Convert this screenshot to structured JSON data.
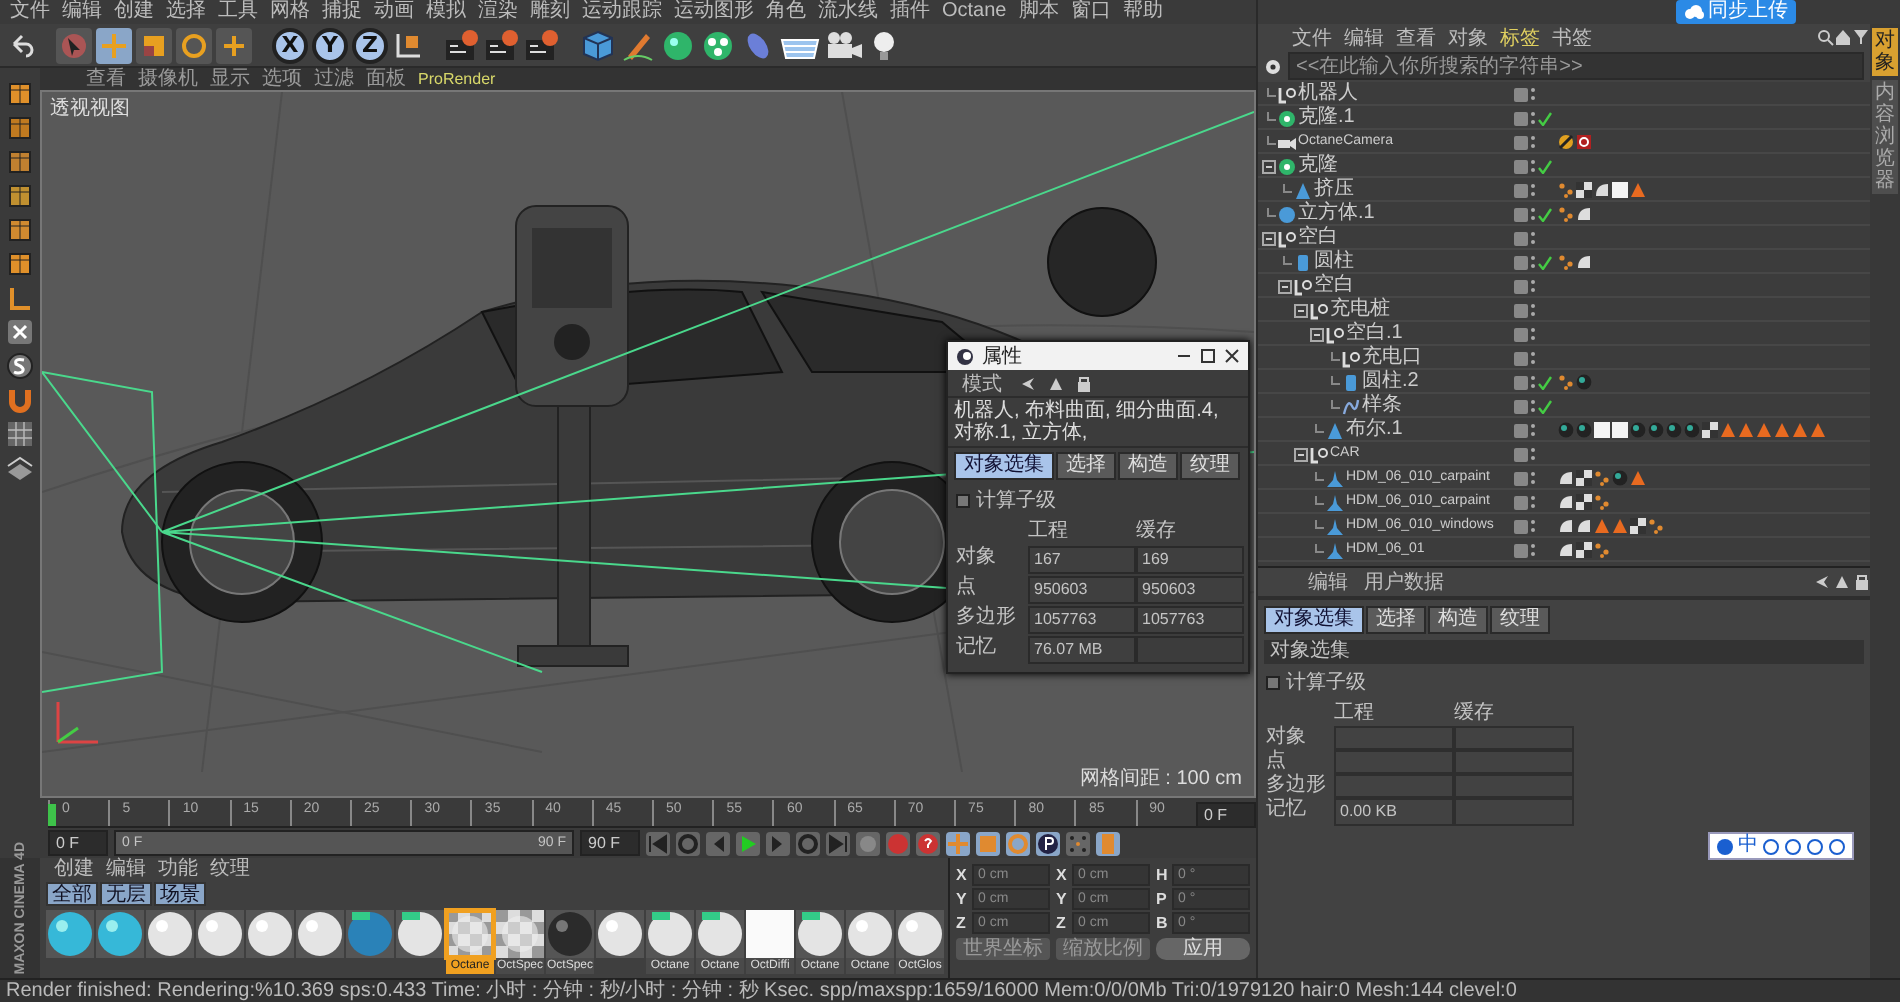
{
  "menu_bar": [
    "文件",
    "编辑",
    "创建",
    "选择",
    "工具",
    "网格",
    "捕捉",
    "动画",
    "模拟",
    "渲染",
    "雕刻",
    "运动跟踪",
    "运动图形",
    "角色",
    "流水线",
    "插件",
    "Octane",
    "脚本",
    "窗口",
    "帮助"
  ],
  "toolbar": {
    "tools": [
      {
        "kind": "select",
        "selected": false
      },
      {
        "kind": "move",
        "selected": true
      },
      {
        "kind": "scale",
        "selected": false
      },
      {
        "kind": "rotate",
        "selected": false
      },
      {
        "kind": "add",
        "selected": false
      }
    ],
    "axes": [
      {
        "label": "X",
        "selected": true
      },
      {
        "label": "Y",
        "selected": true
      },
      {
        "label": "Z",
        "selected": true
      }
    ]
  },
  "viewport": {
    "menu": [
      "查看",
      "摄像机",
      "显示",
      "选项",
      "过滤",
      "面板",
      "ProRender"
    ],
    "label": "透视视图",
    "grid_spacing": "网格间距 : 100 cm"
  },
  "floating_window": {
    "title": "属性",
    "mode": "模式",
    "breadcrumb": "机器人, 布料曲面, 细分曲面.4, 对称.1, 立方体,",
    "tabs": [
      {
        "label": "对象选集",
        "selected": true
      },
      {
        "label": "选择",
        "selected": false
      },
      {
        "label": "构造",
        "selected": false
      },
      {
        "label": "纹理",
        "selected": false
      }
    ],
    "checkbox": {
      "label": "计算子级",
      "checked": false
    },
    "columns": [
      "工程",
      "缓存"
    ],
    "rows": [
      {
        "label": "对象",
        "values": [
          "167",
          "169"
        ]
      },
      {
        "label": "点",
        "values": [
          "950603",
          "950603"
        ]
      },
      {
        "label": "多边形",
        "values": [
          "1057763",
          "1057763"
        ]
      },
      {
        "label": "记忆",
        "values": [
          "76.07 MB"
        ]
      }
    ]
  },
  "upload_button": "同步上传",
  "object_manager": {
    "menu": [
      {
        "label": "文件",
        "selected": false
      },
      {
        "label": "编辑",
        "selected": false
      },
      {
        "label": "查看",
        "selected": false
      },
      {
        "label": "对象",
        "selected": false
      },
      {
        "label": "标签",
        "selected": true
      },
      {
        "label": "书签",
        "selected": false
      }
    ],
    "search": {
      "placeholder": "<<在此输入你所搜索的字符串>>"
    },
    "objects": [
      {
        "name": "机器人",
        "kind": "null",
        "enabled": false
      },
      {
        "name": "克隆.1",
        "kind": "cloner",
        "enabled": true
      },
      {
        "name": "OctaneCamera",
        "kind": "camera",
        "enabled": false,
        "tags": [
          {
            "kind": "target"
          },
          {
            "kind": "octane"
          }
        ]
      },
      {
        "name": "克隆",
        "kind": "cloner",
        "enabled": true,
        "children": [
          {
            "name": "挤压",
            "kind": "generator",
            "enabled": false,
            "tags": [
              {
                "kind": "dots"
              },
              {
                "kind": "texture"
              },
              {
                "kind": "phong"
              },
              {
                "kind": "white"
              },
              {
                "kind": "triangle"
              }
            ]
          }
        ]
      },
      {
        "name": "立方体.1",
        "kind": "primitive",
        "enabled": true,
        "tags": [
          {
            "kind": "dots"
          },
          {
            "kind": "phong"
          }
        ]
      },
      {
        "name": "空白",
        "kind": "null",
        "enabled": false,
        "children": [
          {
            "name": "圆柱",
            "kind": "cylinder",
            "enabled": true,
            "tags": [
              {
                "kind": "dots"
              },
              {
                "kind": "phong"
              }
            ]
          },
          {
            "name": "空白",
            "kind": "null",
            "enabled": false,
            "children": [
              {
                "name": "充电桩",
                "kind": "null",
                "enabled": false,
                "children": [
                  {
                    "name": "空白.1",
                    "kind": "null",
                    "enabled": false,
                    "children": [
                      {
                        "name": "充电口",
                        "kind": "null",
                        "enabled": false
                      },
                      {
                        "name": "圆柱.2",
                        "kind": "cylinder",
                        "enabled": true,
                        "tags": [
                          {
                            "kind": "dots"
                          },
                          {
                            "kind": "sphere"
                          }
                        ]
                      },
                      {
                        "name": "样条",
                        "kind": "spline",
                        "enabled": true
                      }
                    ]
                  },
                  {
                    "name": "布尔.1",
                    "kind": "generator",
                    "enabled": false,
                    "tags": [
                      {
                        "kind": "sphere"
                      },
                      {
                        "kind": "sphere"
                      },
                      {
                        "kind": "white"
                      },
                      {
                        "kind": "white"
                      },
                      {
                        "kind": "sphere"
                      },
                      {
                        "kind": "sphere"
                      },
                      {
                        "kind": "sphere"
                      },
                      {
                        "kind": "sphere"
                      },
                      {
                        "kind": "texture"
                      },
                      {
                        "kind": "triangle"
                      },
                      {
                        "kind": "triangle"
                      },
                      {
                        "kind": "triangle"
                      },
                      {
                        "kind": "triangle"
                      },
                      {
                        "kind": "triangle"
                      },
                      {
                        "kind": "triangle"
                      }
                    ]
                  }
                ]
              },
              {
                "name": "CAR",
                "kind": "null",
                "enabled": false,
                "children": [
                  {
                    "name": "HDM_06_010_carpaint",
                    "kind": "mesh",
                    "enabled": false,
                    "tags": [
                      {
                        "kind": "phong"
                      },
                      {
                        "kind": "texture"
                      },
                      {
                        "kind": "dots"
                      },
                      {
                        "kind": "sphere"
                      },
                      {
                        "kind": "triangle"
                      }
                    ]
                  },
                  {
                    "name": "HDM_06_010_carpaint",
                    "kind": "mesh",
                    "enabled": false,
                    "tags": [
                      {
                        "kind": "phong"
                      },
                      {
                        "kind": "texture"
                      },
                      {
                        "kind": "dots"
                      }
                    ]
                  },
                  {
                    "name": "HDM_06_010_windows",
                    "kind": "mesh",
                    "enabled": false,
                    "tags": [
                      {
                        "kind": "phong"
                      },
                      {
                        "kind": "phong"
                      },
                      {
                        "kind": "triangle"
                      },
                      {
                        "kind": "triangle"
                      },
                      {
                        "kind": "texture"
                      },
                      {
                        "kind": "dots"
                      }
                    ]
                  },
                  {
                    "name": "HDM_06_01",
                    "kind": "mesh",
                    "enabled": false,
                    "tags": [
                      {
                        "kind": "phong"
                      },
                      {
                        "kind": "texture"
                      },
                      {
                        "kind": "dots"
                      }
                    ]
                  }
                ]
              }
            ]
          }
        ]
      }
    ]
  },
  "attributes": {
    "menu": [
      "编辑",
      "用户数据"
    ],
    "tabs": [
      {
        "label": "对象选集",
        "selected": true
      },
      {
        "label": "选择",
        "selected": false
      },
      {
        "label": "构造",
        "selected": false
      },
      {
        "label": "纹理",
        "selected": false
      }
    ],
    "section": "对象选集",
    "checkbox": {
      "label": "计算子级",
      "checked": false
    },
    "columns": [
      "工程",
      "缓存"
    ],
    "rows": [
      {
        "label": "对象",
        "values": []
      },
      {
        "label": "点",
        "values": []
      },
      {
        "label": "多边形",
        "values": []
      },
      {
        "label": "记忆",
        "values": [
          "0.00 KB"
        ]
      }
    ]
  },
  "side_tabs": [
    {
      "label": "对象",
      "selected": true
    },
    {
      "label": "内容浏览器",
      "selected": false
    }
  ],
  "ime_bar": {
    "label": "中"
  },
  "logo_strip": "MAXON CINEMA 4D",
  "timeline": {
    "ticks": [
      "0",
      "5",
      "10",
      "15",
      "20",
      "25",
      "30",
      "35",
      "40",
      "45",
      "50",
      "55",
      "60",
      "65",
      "70",
      "75",
      "80",
      "85",
      "90"
    ],
    "current": "0 F"
  },
  "transport": {
    "start": "0 F",
    "range_start": "0 F",
    "range_end": "90 F",
    "end": "90 F"
  },
  "materials": {
    "menu": [
      "创建",
      "编辑",
      "功能",
      "纹理"
    ],
    "filters": [
      {
        "label": "全部",
        "selected": true
      },
      {
        "label": "无层",
        "selected": true
      },
      {
        "label": "场景",
        "selected": true
      }
    ],
    "swatches": [
      {
        "kind": "cyan",
        "selected": false
      },
      {
        "kind": "cyan",
        "selected": false
      },
      {
        "kind": "white",
        "selected": false
      },
      {
        "kind": "white",
        "selected": false
      },
      {
        "kind": "white",
        "selected": false
      },
      {
        "kind": "white",
        "selected": false
      },
      {
        "kind": "blue",
        "selected": false
      },
      {
        "kind": "tagged",
        "selected": false
      },
      {
        "kind": "checker",
        "label": "Octane",
        "selected": true
      },
      {
        "kind": "checker",
        "label": "OctSpec",
        "selected": false
      },
      {
        "kind": "dark",
        "label": "OctSpec",
        "selected": false
      },
      {
        "kind": "white",
        "selected": false
      },
      {
        "kind": "tagged",
        "label": "Octane",
        "selected": false
      },
      {
        "kind": "tagged",
        "label": "Octane",
        "selected": false
      },
      {
        "kind": "flat",
        "label": "OctDiffi",
        "selected": false
      },
      {
        "kind": "tagged",
        "label": "Octane",
        "selected": false
      },
      {
        "kind": "white",
        "label": "Octane",
        "selected": false
      },
      {
        "kind": "white",
        "label": "OctGlos",
        "selected": false
      }
    ]
  },
  "coordinates": {
    "columns": [
      [
        {
          "axis": "X",
          "value": "0 cm"
        },
        {
          "axis": "Y",
          "value": "0 cm"
        },
        {
          "axis": "Z",
          "value": "0 cm"
        }
      ],
      [
        {
          "axis": "X",
          "value": "0 cm"
        },
        {
          "axis": "Y",
          "value": "0 cm"
        },
        {
          "axis": "Z",
          "value": "0 cm"
        }
      ],
      [
        {
          "axis": "H",
          "value": "0 °"
        },
        {
          "axis": "P",
          "value": "0 °"
        },
        {
          "axis": "B",
          "value": "0 °"
        }
      ]
    ],
    "dropdowns": [
      "世界坐标",
      "缩放比例"
    ],
    "apply": "应用"
  },
  "status_bar": "Render finished: Rendering:%10.369 sps:0.433 Time: 小时 : 分钟 : 秒/小时 : 分钟 : 秒 Ksec. spp/maxspp:1659/16000 Mem:0/0/0Mb Tri:0/1979120 hair:0 Mesh:144 clevel:0"
}
